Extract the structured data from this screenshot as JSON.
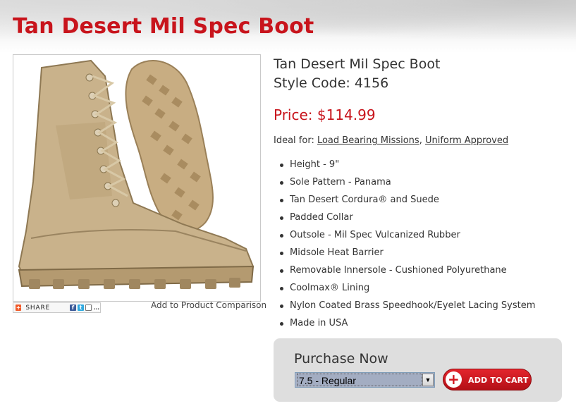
{
  "page": {
    "title": "Tan Desert Mil Spec Boot"
  },
  "product": {
    "name": "Tan Desert Mil Spec Boot",
    "style_code": "Style Code: 4156",
    "price": "Price: $114.99",
    "ideal_for_label": "Ideal for: ",
    "ideal_for": [
      "Load Bearing Missions",
      "Uniform Approved"
    ],
    "ideal_sep": ", ",
    "features": [
      "Height - 9\"",
      "Sole Pattern - Panama",
      "Tan Desert Cordura® and Suede",
      "Padded Collar",
      "Outsole - Mil Spec Vulcanized Rubber",
      "Midsole Heat Barrier",
      "Removable Innersole - Cushioned Polyurethane",
      "Coolmax® Lining",
      "Nylon Coated Brass Speedhook/Eyelet Lacing System",
      "Made in USA"
    ]
  },
  "share": {
    "label": "SHARE",
    "services": [
      "facebook-icon",
      "twitter-icon",
      "email-icon",
      "more-icon"
    ]
  },
  "compare": {
    "label": "Add to Product Comparison"
  },
  "purchase": {
    "title": "Purchase Now",
    "selected_size": "7.5 - Regular",
    "button_label": "ADD TO CART"
  },
  "colors": {
    "brand_red": "#c8141c",
    "purchase_bg": "#dedede",
    "boot_tan": "#c9b28b"
  }
}
